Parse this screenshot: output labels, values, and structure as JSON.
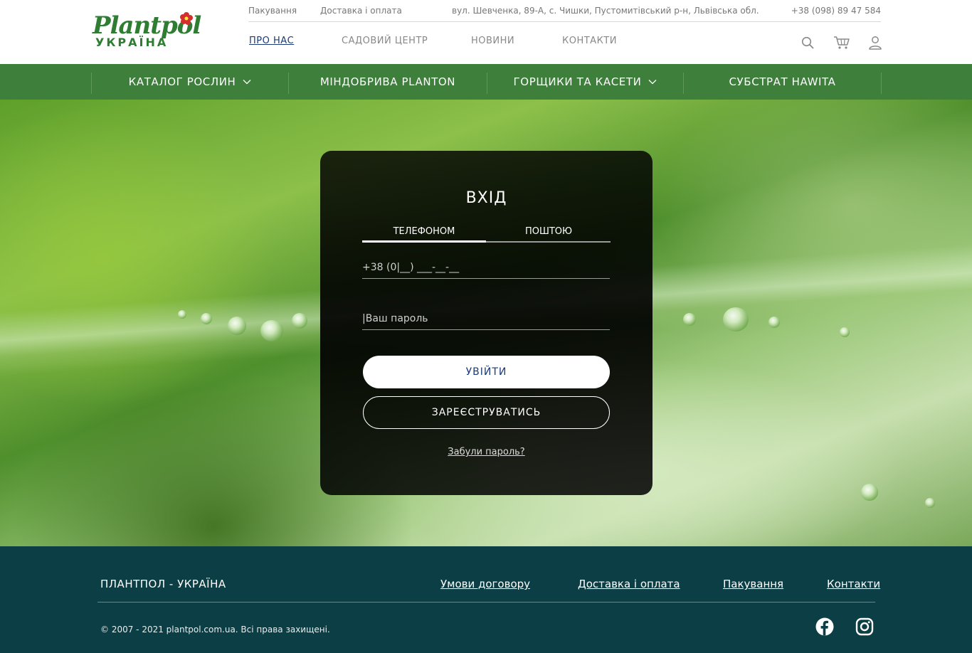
{
  "logo": {
    "main": "Plantpol",
    "sub": "УКРАЇНА"
  },
  "topbar": {
    "packaging": "Пакування",
    "delivery": "Доставка і оплата",
    "address": "вул. Шевченка, 89-А, с. Чишки, Пустомитівський р-н, Львівська обл.",
    "phone": "+38 (098) 89 47 584"
  },
  "nav": {
    "about": "ПРО НАС",
    "garden": "САДОВИЙ ЦЕНТР",
    "news": "НОВИНИ",
    "contacts": "КОНТАКТИ"
  },
  "icons": {
    "search": "search-icon",
    "cart": "cart-icon",
    "user": "user-icon"
  },
  "categories": [
    {
      "label": "КАТАЛОГ РОСЛИН",
      "dropdown": true
    },
    {
      "label": "МІНДОБРИВА PLANTON",
      "dropdown": false
    },
    {
      "label": "ГОРЩИКИ ТА КАСЕТИ",
      "dropdown": true
    },
    {
      "label": "СУБСТРАТ HAWITA",
      "dropdown": false
    }
  ],
  "login": {
    "title": "ВХІД",
    "tab_phone": "ТЕЛЕФОНОМ",
    "tab_mail": "ПОШТОЮ",
    "active_tab": "ТЕЛЕФОНОМ",
    "phone_placeholder": "+38 (0|__) ___-__-__",
    "password_placeholder": "|Ваш пароль",
    "login_button": "УВІЙТИ",
    "register_button": "ЗАРЕЄСТРУВАТИСЬ",
    "forgot_link": "Забули пароль?"
  },
  "footer": {
    "brand": "ПЛАНТПОЛ - УКРАЇНА",
    "links": [
      "Умови договору",
      "Доставка і оплата",
      "Пакування",
      "Контакти"
    ],
    "copyright": "© 2007 - 2021 plantpol.com.ua. Всі права захищені.",
    "social": [
      "facebook-icon",
      "instagram-icon"
    ]
  },
  "colors": {
    "brand_green": "#2e7d32",
    "category_bar": "#3d7f3b",
    "footer_bg": "#0b3e45",
    "active_nav": "#1a3a7a"
  }
}
